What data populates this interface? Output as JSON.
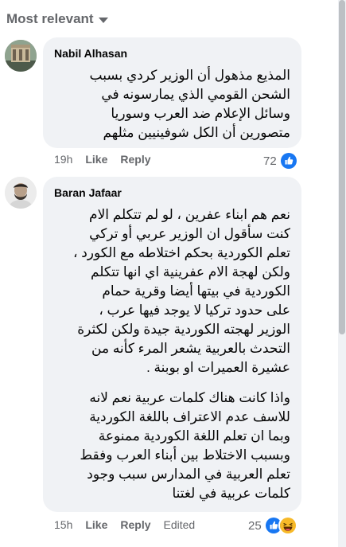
{
  "header": {
    "sort_label": "Most relevant"
  },
  "comments": [
    {
      "author": "Nabil Alhasan",
      "paragraphs": [
        [
          "المذيع مذهول أن الوزير كردي بسبب",
          "الشحن القومي الذي يمارسونه في",
          "وسائل الإعلام ضد العرب وسوريا",
          "متصورين أن الكل شوفينيين مثلهم"
        ]
      ],
      "time": "19h",
      "like_label": "Like",
      "reply_label": "Reply",
      "edited_label": "",
      "reaction_count": "72",
      "reactions": [
        "like-icon"
      ]
    },
    {
      "author": "Baran Jafaar",
      "paragraphs": [
        [
          "نعم هم ابناء عفرين ، لو لم تتكلم الام",
          "كنت سأقول ان الوزير عربي أو تركي",
          "تعلم الكوردية بحكم اختلاطه مع الكورد ،",
          "ولكن لهجة الام عفرينية اي انها تتكلم",
          "الكوردية في بيتها أيضا وقرية حمام",
          "على حدود تركيا لا يوجد فيها عرب ،",
          "الوزير لهجته الكوردية جيدة ولكن لكثرة",
          "التحدث بالعربية يشعر المرء كأنه من",
          "عشيرة العميرات او بوبنة ."
        ],
        [
          "واذا كانت هناك كلمات عربية نعم لانه",
          "للاسف عدم الاعتراف باللغة الكوردية",
          "وبما ان تعلم اللغة الكوردية ممنوعة",
          "وبسبب الاختلاط بين أبناء العرب وفقط",
          "تعلم العربية في المدارس سبب وجود",
          "كلمات عربية في لغتنا"
        ]
      ],
      "time": "15h",
      "like_label": "Like",
      "reply_label": "Reply",
      "edited_label": "Edited",
      "reaction_count": "25",
      "reactions": [
        "like-icon",
        "haha-icon"
      ]
    }
  ],
  "colors": {
    "bubble": "#f0f2f5",
    "secondary_text": "#65676b",
    "like_blue": "#1877f2",
    "haha_yellow": "#f7b928"
  }
}
